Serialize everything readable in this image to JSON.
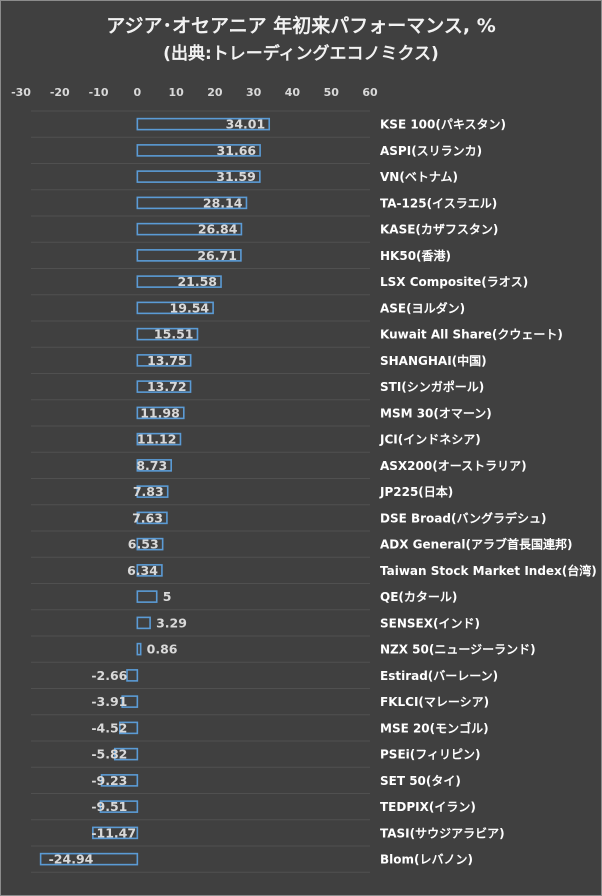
{
  "chart_data": {
    "type": "bar",
    "orientation": "horizontal",
    "title": "アジア･オセアニア 年初来パフォーマンス, %",
    "subtitle": "(出典:トレーディングエコノミクス)",
    "xlim": [
      -30,
      60
    ],
    "xticks": [
      "-30",
      "-20",
      "-10",
      "0",
      "10",
      "20",
      "30",
      "40",
      "50",
      "60"
    ],
    "xtick_values": [
      -30,
      -20,
      -10,
      0,
      10,
      20,
      30,
      40,
      50,
      60
    ],
    "axis_position": "top",
    "grid": false,
    "colors": {
      "bar_edge": "#5b9bd5",
      "background": "#404040"
    },
    "categories": [
      "KSE 100(パキスタン)",
      "ASPI(スリランカ)",
      "VN(ベトナム)",
      "TA-125(イスラエル)",
      "KASE(カザフスタン)",
      "HK50(香港)",
      "LSX Composite(ラオス)",
      "ASE(ヨルダン)",
      "Kuwait All Share(クウェート)",
      "SHANGHAI(中国)",
      "STI(シンガポール)",
      "MSM 30(オマーン)",
      "JCI(インドネシア)",
      "ASX200(オーストラリア)",
      "JP225(日本)",
      "DSE Broad(バングラデシュ)",
      "ADX General(アラブ首長国連邦)",
      "Taiwan Stock Market Index(台湾)",
      "QE(カタール)",
      "SENSEX(インド)",
      "NZX 50(ニュージーランド)",
      "Estirad(バーレーン)",
      "FKLCI(マレーシア)",
      "MSE 20(モンゴル)",
      "PSEi(フィリピン)",
      "SET 50(タイ)",
      "TEDPIX(イラン)",
      "TASI(サウジアラビア)",
      "Blom(レバノン)"
    ],
    "values": [
      34.01,
      31.66,
      31.59,
      28.14,
      26.84,
      26.71,
      21.58,
      19.54,
      15.51,
      13.75,
      13.72,
      11.98,
      11.12,
      8.73,
      7.83,
      7.63,
      6.53,
      6.34,
      5,
      3.29,
      0.86,
      -2.66,
      -3.91,
      -4.52,
      -5.82,
      -9.23,
      -9.51,
      -11.47,
      -24.94
    ],
    "value_labels": [
      "34.01",
      "31.66",
      "31.59",
      "28.14",
      "26.84",
      "26.71",
      "21.58",
      "19.54",
      "15.51",
      "13.75",
      "13.72",
      "11.98",
      "11.12",
      "8.73",
      "7.83",
      "7.63",
      "6.53",
      "6.34",
      "5",
      "3.29",
      "0.86",
      "-2.66",
      "-3.91",
      "-4.52",
      "-5.82",
      "-9.23",
      "-9.51",
      "-11.47",
      "-24.94"
    ]
  }
}
